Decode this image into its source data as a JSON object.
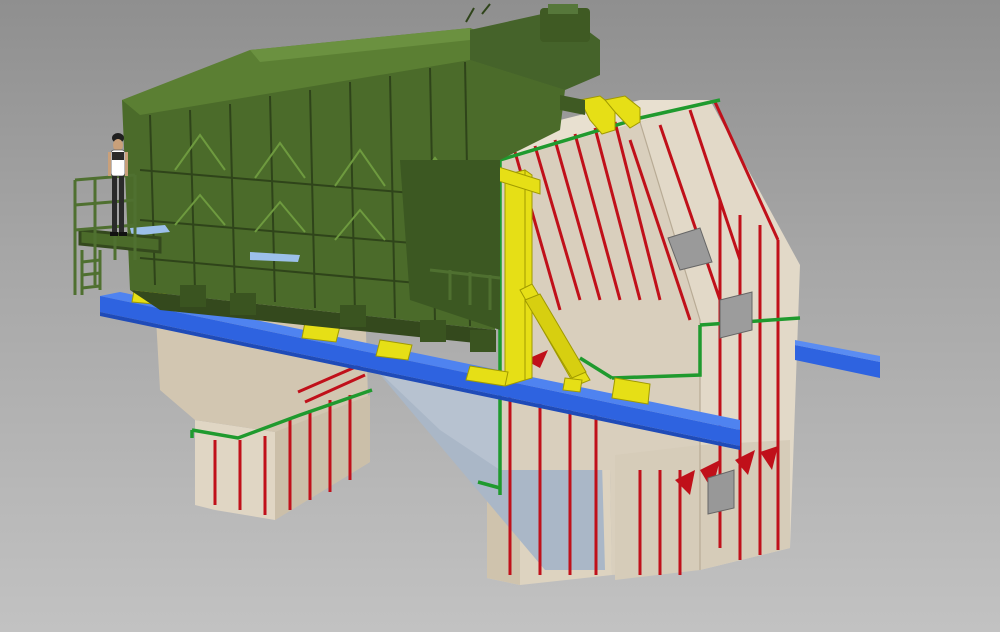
{
  "viewport": {
    "background_top": "#8f8f8f",
    "background_bottom": "#c2c2c2"
  },
  "model": {
    "components": [
      {
        "name": "vibrating-screen",
        "color": "#4b6b2a"
      },
      {
        "name": "drive-motor",
        "color": "#3f5a23"
      },
      {
        "name": "access-platform-railing",
        "color": "#4b6b2a"
      },
      {
        "name": "worker-figure",
        "color": "#2a2a2a"
      },
      {
        "name": "support-beam",
        "color": "#2e63e0"
      },
      {
        "name": "yellow-support-frame",
        "color": "#e6df16"
      },
      {
        "name": "concrete-piers",
        "color": "#d9cfbd"
      },
      {
        "name": "discharge-chute",
        "color": "#aeb8c4"
      },
      {
        "name": "reinforcement-bars",
        "color": "#c0101a"
      },
      {
        "name": "green-steel-bands",
        "color": "#1f9a2e"
      },
      {
        "name": "access-hatch",
        "color": "#8e8e8e"
      }
    ]
  }
}
